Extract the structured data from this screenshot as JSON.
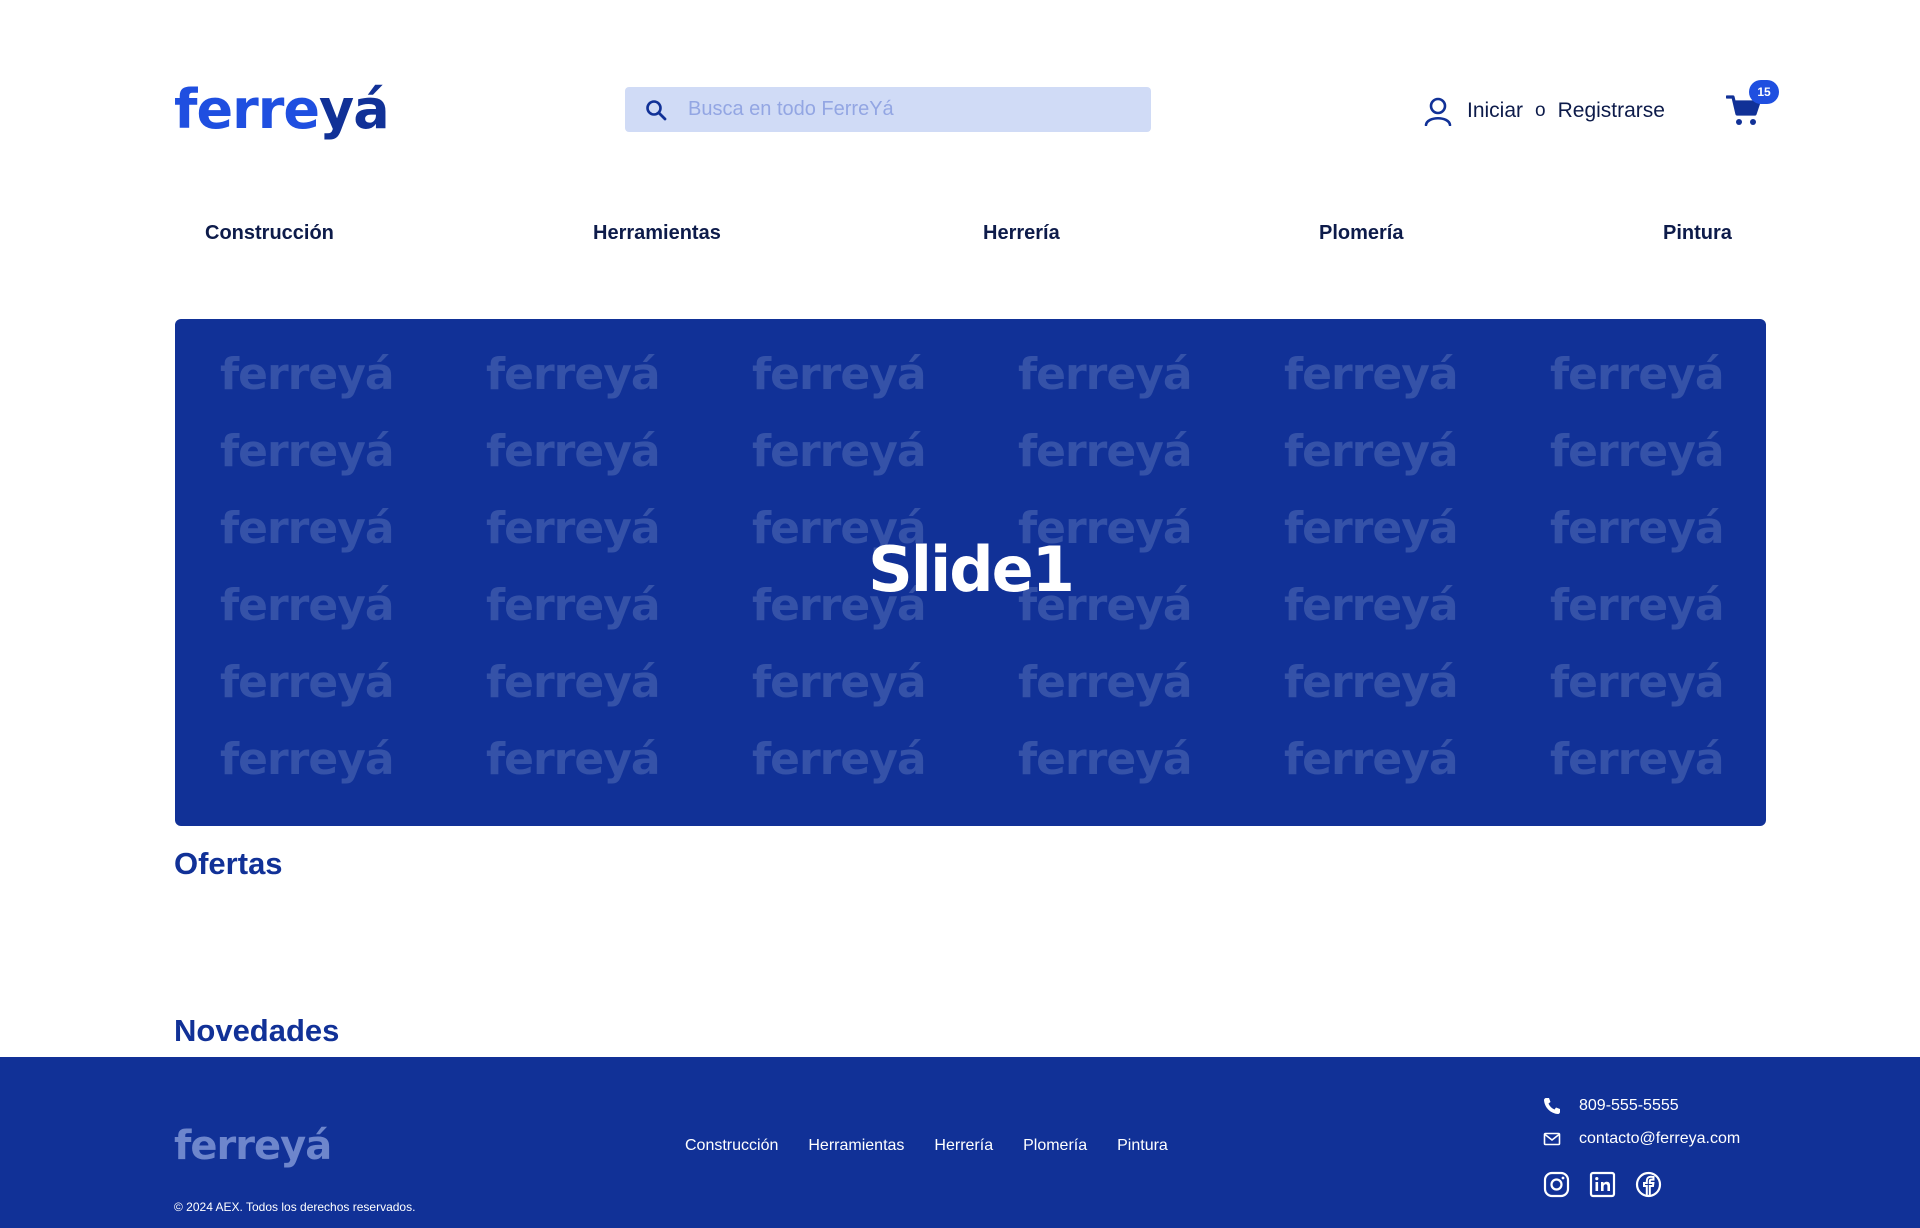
{
  "brand": {
    "logo_part1": "ferre",
    "logo_part2": "yá",
    "primary_color": "#1f4fe0",
    "dark_color": "#113197"
  },
  "header": {
    "search": {
      "placeholder": "Busca en todo FerreYá"
    },
    "account": {
      "login_label": "Iniciar",
      "separator": "o",
      "register_label": "Registrarse"
    },
    "cart": {
      "count": "15"
    }
  },
  "nav": {
    "items": [
      {
        "label": "Construcción"
      },
      {
        "label": "Herramientas"
      },
      {
        "label": "Herrería"
      },
      {
        "label": "Plomería"
      },
      {
        "label": "Pintura"
      }
    ]
  },
  "hero": {
    "slide_title": "Slide1",
    "watermark_text": "ferreyá",
    "background_color": "#113197"
  },
  "sections": {
    "offers_title": "Ofertas",
    "news_title": "Novedades"
  },
  "footer": {
    "logo": "ferreyá",
    "nav": [
      {
        "label": "Construcción"
      },
      {
        "label": "Herramientas"
      },
      {
        "label": "Herrería"
      },
      {
        "label": "Plomería"
      },
      {
        "label": "Pintura"
      }
    ],
    "copyright": "© 2024 AEX. Todos los derechos reservados.",
    "phone": "809-555-5555",
    "email": "contacto@ferreya.com",
    "social": [
      {
        "icon": "instagram-icon"
      },
      {
        "icon": "linkedin-icon"
      },
      {
        "icon": "facebook-icon"
      }
    ]
  }
}
